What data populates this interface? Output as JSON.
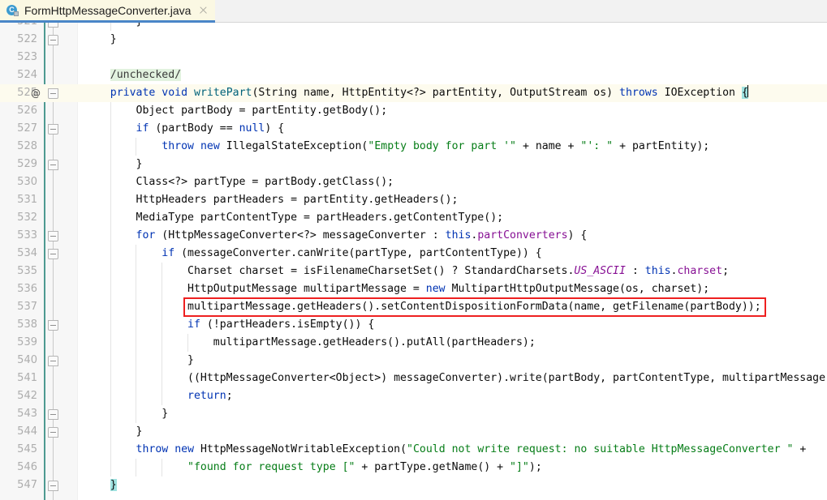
{
  "window": {
    "app": "java-source-editor"
  },
  "tabbar": {
    "tabs": [
      {
        "title": "FormHttpMessageConverter.java",
        "icon": "java-class-icon",
        "icon_letter": "C",
        "active": true,
        "close_label": "×"
      }
    ]
  },
  "editor": {
    "caret_line": 525,
    "highlight_box_line": 537,
    "colors": {
      "keyword": "#0033b3",
      "string": "#067d17",
      "field": "#871094",
      "static_field": "#871094",
      "method": "#00627a",
      "comment_highlight_bg": "#e2f2df",
      "caret_line_bg": "#fdfbee",
      "brace_match_bg": "#9fe2e0",
      "annotation_box": "#ee2020",
      "change_marker": "#4e9a91",
      "gutter_bg": "#f7f7f7",
      "line_number": "#adadad",
      "tab_active_bg": "#fbf8e3",
      "tab_underline": "#4a86c8"
    },
    "lines": [
      {
        "n": "521",
        "annot": "",
        "fold": "up",
        "indent": 2,
        "text": "}",
        "clipped_top": true
      },
      {
        "n": "522",
        "annot": "",
        "fold": "up",
        "indent": 1,
        "text": "}"
      },
      {
        "n": "523",
        "annot": "",
        "fold": "",
        "indent": 0,
        "text": ""
      },
      {
        "n": "524",
        "annot": "",
        "fold": "",
        "indent": 1,
        "text": "/unchecked/"
      },
      {
        "n": "525",
        "annot": "@",
        "fold": "down",
        "indent": 1,
        "text": "private void writePart(String name, HttpEntity<?> partEntity, OutputStream os) throws IOException {"
      },
      {
        "n": "526",
        "annot": "",
        "fold": "",
        "indent": 2,
        "text": "Object partBody = partEntity.getBody();"
      },
      {
        "n": "527",
        "annot": "",
        "fold": "down",
        "indent": 2,
        "text": "if (partBody == null) {"
      },
      {
        "n": "528",
        "annot": "",
        "fold": "",
        "indent": 3,
        "text": "throw new IllegalStateException(\"Empty body for part '\" + name + \"': \" + partEntity);"
      },
      {
        "n": "529",
        "annot": "",
        "fold": "up",
        "indent": 2,
        "text": "}"
      },
      {
        "n": "530",
        "annot": "",
        "fold": "",
        "indent": 2,
        "text": "Class<?> partType = partBody.getClass();"
      },
      {
        "n": "531",
        "annot": "",
        "fold": "",
        "indent": 2,
        "text": "HttpHeaders partHeaders = partEntity.getHeaders();"
      },
      {
        "n": "532",
        "annot": "",
        "fold": "",
        "indent": 2,
        "text": "MediaType partContentType = partHeaders.getContentType();"
      },
      {
        "n": "533",
        "annot": "",
        "fold": "down",
        "indent": 2,
        "text": "for (HttpMessageConverter<?> messageConverter : this.partConverters) {"
      },
      {
        "n": "534",
        "annot": "",
        "fold": "down",
        "indent": 3,
        "text": "if (messageConverter.canWrite(partType, partContentType)) {"
      },
      {
        "n": "535",
        "annot": "",
        "fold": "",
        "indent": 4,
        "text": "Charset charset = isFilenameCharsetSet() ? StandardCharsets.US_ASCII : this.charset;"
      },
      {
        "n": "536",
        "annot": "",
        "fold": "",
        "indent": 4,
        "text": "HttpOutputMessage multipartMessage = new MultipartHttpOutputMessage(os, charset);"
      },
      {
        "n": "537",
        "annot": "",
        "fold": "",
        "indent": 4,
        "text": "multipartMessage.getHeaders().setContentDispositionFormData(name, getFilename(partBody));"
      },
      {
        "n": "538",
        "annot": "",
        "fold": "down",
        "indent": 4,
        "text": "if (!partHeaders.isEmpty()) {"
      },
      {
        "n": "539",
        "annot": "",
        "fold": "",
        "indent": 5,
        "text": "multipartMessage.getHeaders().putAll(partHeaders);"
      },
      {
        "n": "540",
        "annot": "",
        "fold": "up",
        "indent": 4,
        "text": "}"
      },
      {
        "n": "541",
        "annot": "",
        "fold": "",
        "indent": 4,
        "text": "((HttpMessageConverter<Object>) messageConverter).write(partBody, partContentType, multipartMessage);"
      },
      {
        "n": "542",
        "annot": "",
        "fold": "",
        "indent": 4,
        "text": "return;"
      },
      {
        "n": "543",
        "annot": "",
        "fold": "up",
        "indent": 3,
        "text": "}"
      },
      {
        "n": "544",
        "annot": "",
        "fold": "up",
        "indent": 2,
        "text": "}"
      },
      {
        "n": "545",
        "annot": "",
        "fold": "",
        "indent": 2,
        "text": "throw new HttpMessageNotWritableException(\"Could not write request: no suitable HttpMessageConverter \" +"
      },
      {
        "n": "546",
        "annot": "",
        "fold": "",
        "indent": 4,
        "text": "\"found for request type [\" + partType.getName() + \"]\");"
      },
      {
        "n": "547",
        "annot": "",
        "fold": "up",
        "indent": 1,
        "text": "}"
      }
    ]
  }
}
